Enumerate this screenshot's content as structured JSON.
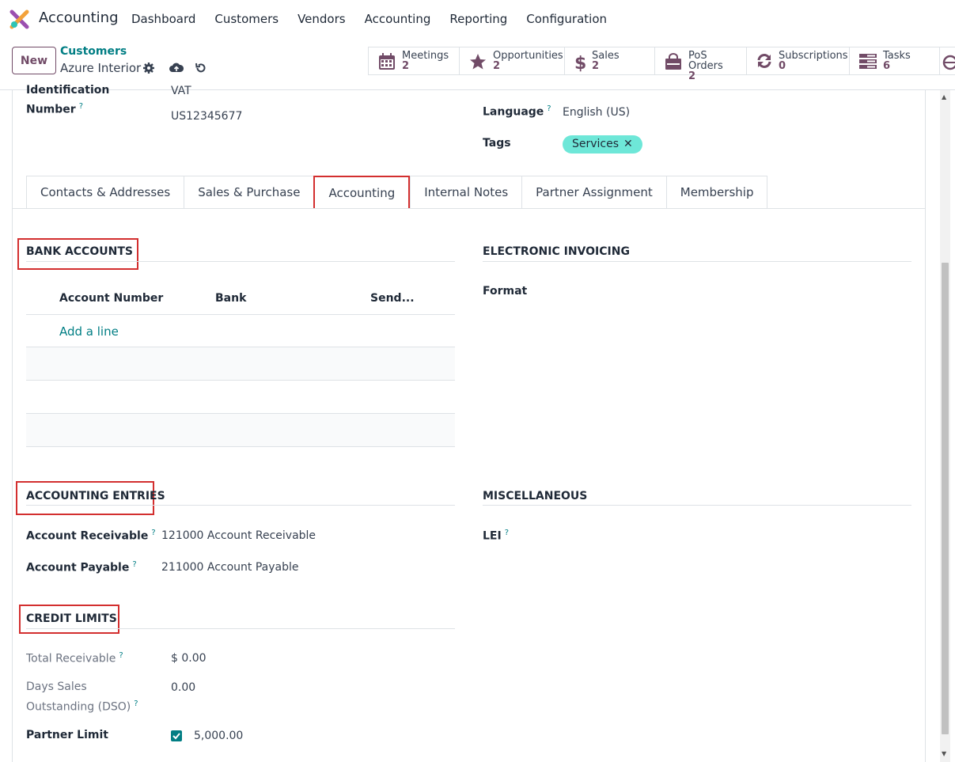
{
  "app": {
    "name": "Accounting"
  },
  "nav": {
    "items": [
      "Dashboard",
      "Customers",
      "Vendors",
      "Accounting",
      "Reporting",
      "Configuration"
    ]
  },
  "control": {
    "new_label": "New",
    "breadcrumb_parent": "Customers",
    "breadcrumb_current": "Azure Interior"
  },
  "smart_buttons": [
    {
      "label": "Meetings",
      "count": "2",
      "icon": "calendar-icon"
    },
    {
      "label": "Opportunities",
      "count": "2",
      "icon": "star-icon"
    },
    {
      "label": "Sales",
      "count": "2",
      "icon": "dollar-icon"
    },
    {
      "label": "PoS Orders",
      "count": "2",
      "icon": "shopping-bag-icon"
    },
    {
      "label": "Subscriptions",
      "count": "0",
      "icon": "refresh-icon"
    },
    {
      "label": "Tasks",
      "count": "6",
      "icon": "tasks-icon"
    }
  ],
  "header_fields": {
    "id_label_line1": "Identification",
    "id_label_line2": "Number",
    "id_help": "?",
    "vat_label": "VAT",
    "vat_value": "US12345677",
    "language_label": "Language",
    "language_help": "?",
    "language_value": "English (US)",
    "tags_label": "Tags",
    "tag": "Services"
  },
  "tabs": [
    "Contacts & Addresses",
    "Sales & Purchase",
    "Accounting",
    "Internal Notes",
    "Partner Assignment",
    "Membership"
  ],
  "bank": {
    "title": "BANK ACCOUNTS",
    "col_account": "Account Number",
    "col_bank": "Bank",
    "col_send": "Send...",
    "add_line": "Add a line"
  },
  "einvoicing": {
    "title": "ELECTRONIC INVOICING",
    "format_label": "Format"
  },
  "entries": {
    "title": "ACCOUNTING ENTRIES",
    "receivable_label": "Account Receivable",
    "receivable_value": "121000 Account Receivable",
    "payable_label": "Account Payable",
    "payable_value": "211000 Account Payable"
  },
  "misc": {
    "title": "MISCELLANEOUS",
    "lei_label": "LEI"
  },
  "credit": {
    "title": "CREDIT LIMITS",
    "total_receivable_label": "Total Receivable",
    "total_receivable_value": "$ 0.00",
    "dso_label_line1": "Days Sales",
    "dso_label_line2": "Outstanding (DSO)",
    "dso_value": "0.00",
    "partner_limit_label": "Partner Limit",
    "partner_limit_checked": true,
    "partner_limit_value": "5,000.00"
  },
  "colors": {
    "brand": "#714b67",
    "link": "#017e84",
    "highlight": "#d32f2f",
    "tag_bg": "#6ee7d8"
  }
}
